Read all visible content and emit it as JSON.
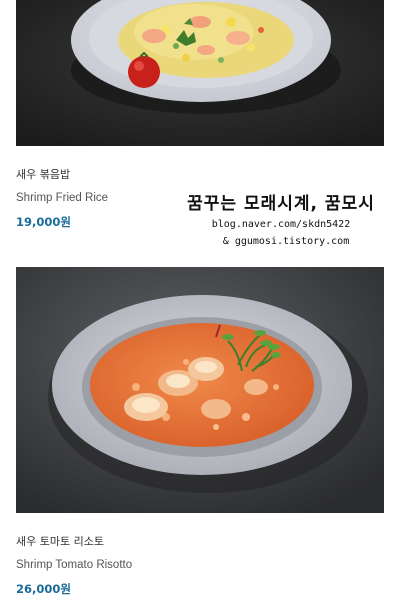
{
  "menu": {
    "items": [
      {
        "korean_name": "새우 볶음밥",
        "english_name": "Shrimp Fried Rice",
        "price": "19,000원",
        "image": "shrimp-fried-rice-photo"
      },
      {
        "korean_name": "새우 토마토 리소토",
        "english_name": "Shrimp Tomato Risotto",
        "price": "26,000원",
        "image": "shrimp-tomato-risotto-photo"
      }
    ]
  },
  "watermark": {
    "title": "꿈꾸는 모래시계, 꿈모시",
    "line1": "blog.naver.com/skdn5422",
    "line2": "& ggumosi.tistory.com"
  },
  "colors": {
    "price": "#1a6b9a",
    "photo_background": "#2a2a2a"
  }
}
